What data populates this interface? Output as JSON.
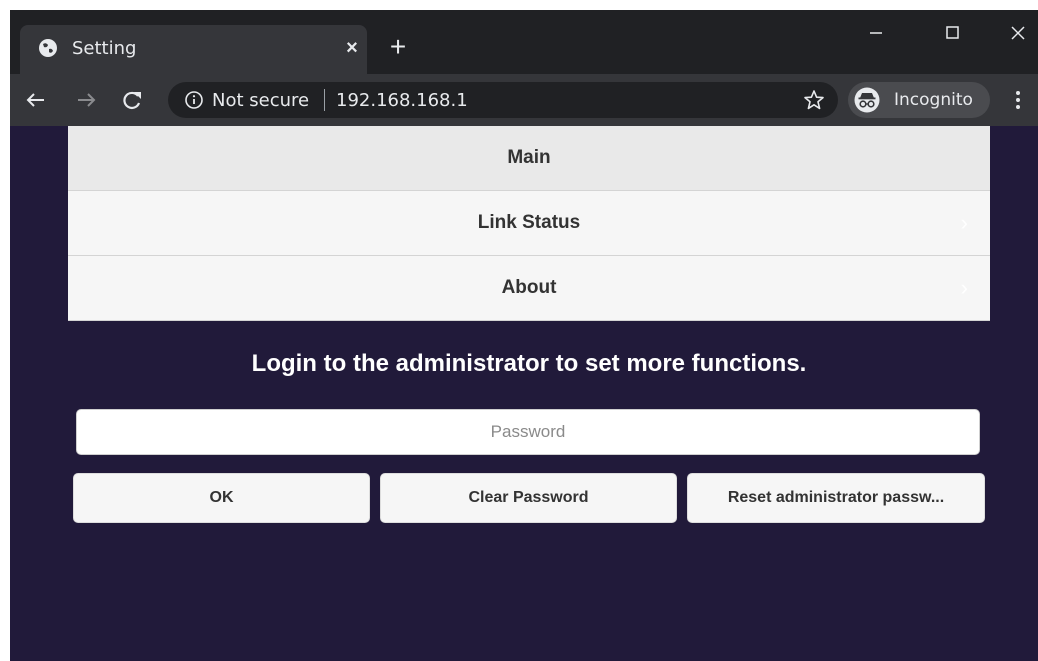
{
  "browser": {
    "tab_title": "Setting",
    "close_symbol": "×",
    "new_tab_symbol": "+",
    "address": {
      "security_label": "Not secure",
      "url": "192.168.168.1"
    },
    "incognito_label": "Incognito",
    "icons": {
      "favicon": "globe-icon",
      "back": "back-arrow-icon",
      "forward": "forward-arrow-icon",
      "reload": "reload-icon",
      "info": "info-icon",
      "bookmark": "star-icon",
      "incognito": "incognito-icon",
      "menu": "kebab-menu-icon",
      "minimize": "minimize-icon",
      "maximize": "maximize-icon",
      "close": "close-icon"
    }
  },
  "page": {
    "background_color": "#211a3a",
    "nav_items": [
      {
        "label": "Main"
      },
      {
        "label": "Link Status"
      },
      {
        "label": "About"
      }
    ],
    "heading": "Login to the administrator to set more functions.",
    "password_placeholder": "Password",
    "buttons": {
      "ok": "OK",
      "clear": "Clear Password",
      "reset": "Reset administrator passw..."
    }
  }
}
